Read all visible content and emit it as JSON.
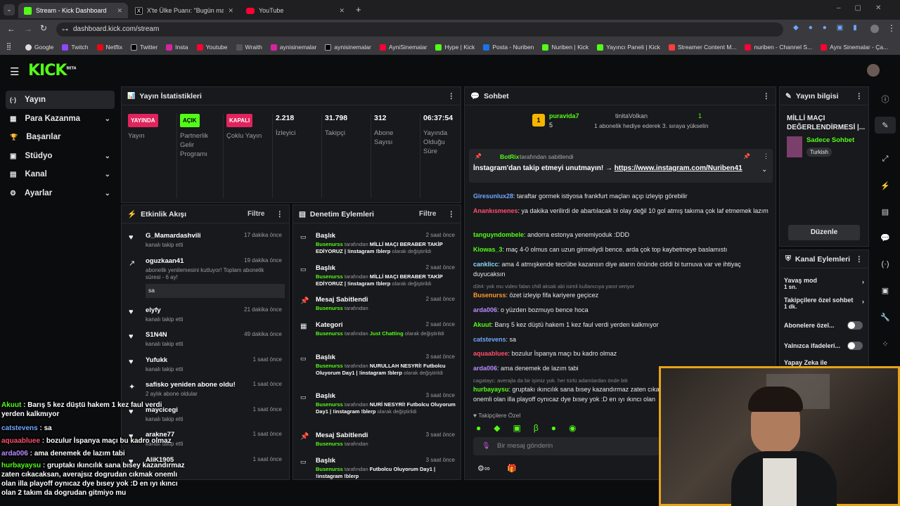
{
  "browser": {
    "tabs": [
      {
        "label": "Stream - Kick Dashboard"
      },
      {
        "label": "X'te Ülke Puanı: \"Bugün maçlar..."
      },
      {
        "label": "YouTube"
      }
    ],
    "url": "dashboard.kick.com/stream",
    "bookmarks": [
      "Google",
      "Twitch",
      "Netflix",
      "Twitter",
      "Insta",
      "Youtube",
      "Wraith",
      "aynisinemalar",
      "aynisinemalar",
      "AyniSinemalar",
      "Hype | Kick",
      "Posta - Nuriben",
      "Nuriben | Kick",
      "Yayıncı Paneli | Kick",
      "Streamer Content M...",
      "nuriben - Channel S...",
      "Aynı Sinemalar - Ça..."
    ]
  },
  "app": {
    "logo": "KICK",
    "logo_sup": "BETA"
  },
  "sidebar": {
    "items": [
      {
        "label": "Yayın",
        "icon": "(·)"
      },
      {
        "label": "Para Kazanma",
        "icon": "▦"
      },
      {
        "label": "Başarılar",
        "icon": "🏆"
      },
      {
        "label": "Stüdyo",
        "icon": "▣"
      },
      {
        "label": "Kanal",
        "icon": "▤"
      },
      {
        "label": "Ayarlar",
        "icon": "⚙"
      }
    ]
  },
  "stats": {
    "title": "Yayın İstatistikleri",
    "items": [
      {
        "badge": "YAYINDA",
        "label": "Yayın"
      },
      {
        "badge": "AÇIK",
        "label": "Partnerlik Gelir Programı"
      },
      {
        "badge": "KAPALI",
        "label": "Çoklu Yayın"
      },
      {
        "value": "2.218",
        "label": "İzleyici"
      },
      {
        "value": "31.798",
        "label": "Takipçi"
      },
      {
        "value": "312",
        "label": "Abone Sayısı"
      },
      {
        "value": "06:37:54",
        "label": "Yayında Olduğu Süre"
      }
    ]
  },
  "events": {
    "title": "Etkinlik Akışı",
    "filter": "Filtre",
    "items": [
      {
        "title": "G_Mamardashvili",
        "sub": "kanalı takip etti",
        "time": "17 dakika önce"
      },
      {
        "title": "oguzkaan41",
        "sub": "abonelik yenilemesini kutluyor! Toplam abonelik süresi - 6 ay!",
        "time": "19 dakika önce",
        "msg": "sa"
      },
      {
        "title": "elyfy",
        "sub": "kanalı takip etti",
        "time": "21 dakika önce"
      },
      {
        "title": "S1N4N",
        "sub": "kanalı takip etti",
        "time": "49 dakika önce"
      },
      {
        "title": "Yufukk",
        "sub": "kanalı takip etti",
        "time": "1 saat önce"
      },
      {
        "title": "safisko yeniden abone oldu!",
        "sub": "2 aylık abone oldular",
        "time": "1 saat önce"
      },
      {
        "title": "maycicegi",
        "sub": "kanalı takip etti",
        "time": "1 saat önce"
      },
      {
        "title": "arakne77",
        "sub": "kanalı takip etti",
        "time": "1 saat önce"
      },
      {
        "title": "AliK1905",
        "sub": "",
        "time": "1 saat önce"
      }
    ]
  },
  "moderation": {
    "title": "Denetim Eylemleri",
    "filter": "Filtre",
    "items": [
      {
        "title": "Başlık",
        "user": "Busenurss",
        "by": "tarafından",
        "value": "MİLLİ MAÇI BERABER TAKİP EDİYORUZ | !instagram !blerp",
        "suffix": "olarak değiştirildi",
        "time": "2 saat önce"
      },
      {
        "title": "Başlık",
        "user": "Busenurss",
        "by": "tarafından",
        "value": "MİLLİ MAÇI BERABER TAKİP EDİYORUZ | !instagram !blerp",
        "suffix": "olarak değiştirildi",
        "time": "2 saat önce"
      },
      {
        "title": "Mesaj Sabitlendi",
        "user": "Busenurss",
        "by": "tarafından",
        "value": "",
        "suffix": "",
        "time": "2 saat önce"
      },
      {
        "title": "Kategori",
        "user": "Busenurss",
        "by": "tarafından",
        "value": "Just Chatting",
        "suffix": "olarak değiştirildi",
        "time": "2 saat önce"
      },
      {
        "title": "Başlık",
        "user": "Busenurss",
        "by": "tarafından",
        "value": "NURULLAH NESYRİ! Futbolcu Oluyorum Day1 | !instagram !blerp",
        "suffix": "olarak değiştirildi",
        "time": "3 saat önce"
      },
      {
        "title": "Başlık",
        "user": "Busenurss",
        "by": "tarafından",
        "value": "NURİ NESYRİ! Futbolcu Oluyorum Day1 | !instagram !blerp",
        "suffix": "olarak değiştirildi",
        "time": "3 saat önce"
      },
      {
        "title": "Mesaj Sabitlendi",
        "user": "Busenurss",
        "by": "tarafından",
        "value": "",
        "suffix": "",
        "time": "3 saat önce"
      },
      {
        "title": "Başlık",
        "user": "Busenurss",
        "by": "tarafından",
        "value": "Futbolcu Oluyorum Day1 | !instagram !blerp",
        "suffix": "olarak değiştirildi",
        "time": "3 saat önce"
      }
    ]
  },
  "chat": {
    "title": "Sohbet",
    "gift": {
      "user": "puravida7",
      "count": "5",
      "target": "tinitaVolkan",
      "target_count": "1",
      "message": "1 abonelik hediye ederek 3. sıraya yükselin"
    },
    "pinned": {
      "user": "BotRix",
      "by": "tarafından sabitlendi",
      "text": "İnstagram'dan takip etmeyi unutmayın! →",
      "link": "https://www.instagram.com/Nuriben41"
    },
    "messages": [
      {
        "user": "Giresunlux28",
        "color": "#6fa8ff",
        "text": "taraftar gormek istiyosa frankfurt maçları açıp izleyip görebilir"
      },
      {
        "user": "Anankısmenes",
        "color": "#ff4f6a",
        "text": "ya dakika verilirdi de abartılacak bi olay değil 10 gol atmış takıma çok laf etmemek lazım"
      },
      {
        "user": "tanguyndombele",
        "color": "#53fc18",
        "text": "andorra estonya yenemiyoduk :DDD"
      },
      {
        "user": "Kiowas_3",
        "color": "#53fc18",
        "text": "maç 4-0 olmus can uzun girmeliydi bence. arda çok top kaybetmeye baslamıstı"
      },
      {
        "user": "canklicc",
        "color": "#8ad8ff",
        "text": "ama 4 atmışkende tecrübe kazansın diye atarın önünde ciddi bi turnuva var ve ihtiyaç duyucaksın"
      },
      {
        "user": "Busenurss",
        "color": "#ff9a2e",
        "text": "özet izleyip fifa kariyere geçicez",
        "reply": "d3t4: yok mu video falan chill aksak abi isimli kullanıcıya yanıt veriyor"
      },
      {
        "user": "arda006",
        "color": "#b98cff",
        "text": "o yüzden bozmuyo bence hoca"
      },
      {
        "user": "Akuut",
        "color": "#53fc18",
        "text": "Barış 5 kez düştü hakem 1 kez faul verdi yerden kalkmıyor"
      },
      {
        "user": "catstevens",
        "color": "#6fa8ff",
        "text": "sa"
      },
      {
        "user": "aquaabluee",
        "color": "#ff4f6a",
        "text": "bozulur İspanya maçı bu kadro olmaz"
      },
      {
        "user": "arda006",
        "color": "#b98cff",
        "text": "ama denemek de lazım tabi"
      },
      {
        "user": "hurbayaysu",
        "color": "#53fc18",
        "text": "gruptakı ıkıncılık sana bısey kazandırmaz zaten cıka onemli olan illa playoff oynıcaz dye bısey yok :D en ıyı ıkıncı olan",
        "reply": "cagatayc: averajla da bir işimiz yok. her türlü adamlardan önde biti"
      }
    ],
    "followers_only": "Takipçilere Özel",
    "placeholder": "Bir mesaj gönderin"
  },
  "info": {
    "title": "Yayın bilgisi",
    "stream_title": "MİLLİ MAÇI DEĞERLENDİRMESİ |...",
    "mode": "Sadece Sohbet",
    "language": "Turkish",
    "edit": "Düzenle"
  },
  "channel_actions": {
    "title": "Kanal Eylemleri",
    "items": [
      {
        "label": "Yavaş mod",
        "value": "1 sn."
      },
      {
        "label": "Takipçilere özel sohbet",
        "value": "1 dk."
      },
      {
        "label": "Abonelere özel...",
        "value": ""
      },
      {
        "label": "Yalnızca ifadeleri...",
        "value": ""
      },
      {
        "label": "Yapay Zeka ile",
        "value": ""
      }
    ]
  },
  "overlay_chat": [
    {
      "user": "Akuut",
      "color": "#53fc18",
      "text": "Barış 5 kez düştü hakem 1 kez faul verdi yerden kalkmıyor"
    },
    {
      "user": "catstevens",
      "color": "#6fa8ff",
      "text": "sa"
    },
    {
      "user": "aquaabluee",
      "color": "#ff4f6a",
      "text": "bozulur İspanya maçı bu kadro olmaz"
    },
    {
      "user": "arda006",
      "color": "#b98cff",
      "text": "ama denemek de lazım tabi"
    },
    {
      "user": "hurbayaysu",
      "color": "#53fc18",
      "text": "gruptakı ıkıncılık sana bısey kazandırmaz zaten cıkacaksan, averajsız dogrudan cıkmak onemlı olan illa playoff oynıcaz dye bısey yok :D en ıyı ıkıncı olan 2 takım da dogrudan gitmiyo mu"
    }
  ]
}
